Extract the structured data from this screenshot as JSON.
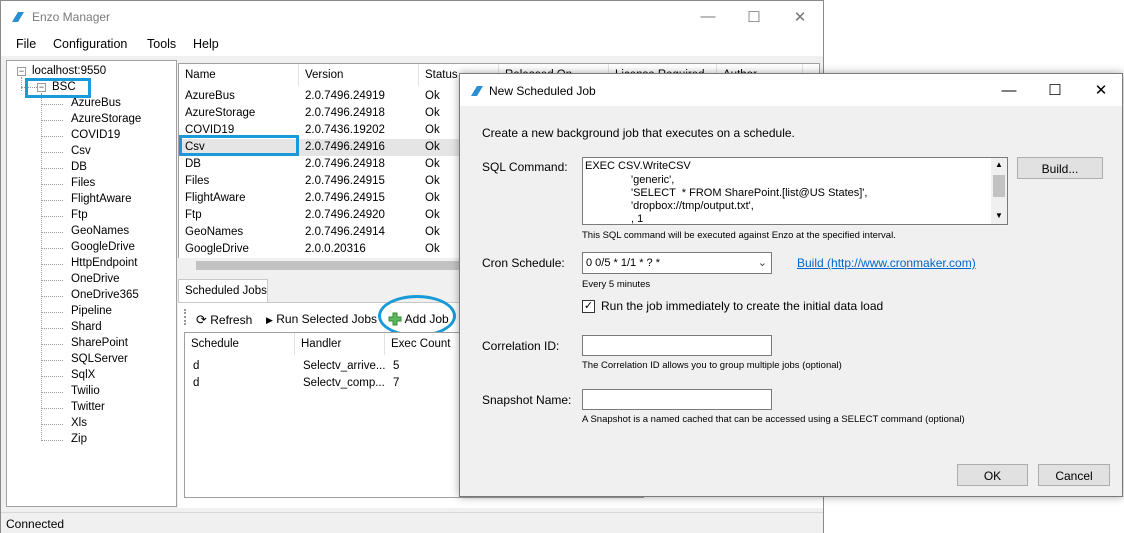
{
  "main_window": {
    "title": "Enzo Manager",
    "menu": [
      "File",
      "Configuration",
      "Tools",
      "Help"
    ],
    "menu_underline": [
      "F",
      "C",
      "",
      ""
    ],
    "status": "Connected"
  },
  "tree": {
    "root": "localhost:9550",
    "selected": "BSC",
    "items": [
      "AzureBus",
      "AzureStorage",
      "COVID19",
      "Csv",
      "DB",
      "Files",
      "FlightAware",
      "Ftp",
      "GeoNames",
      "GoogleDrive",
      "HttpEndpoint",
      "OneDrive",
      "OneDrive365",
      "Pipeline",
      "Shard",
      "SharePoint",
      "SQLServer",
      "SqlX",
      "Twilio",
      "Twitter",
      "Xls",
      "Zip"
    ]
  },
  "adapters_grid": {
    "headers": [
      "Name",
      "Version",
      "Status",
      "Released On",
      "License Required",
      "Author"
    ],
    "rows": [
      [
        "AzureBus",
        "2.0.7496.24919",
        "Ok"
      ],
      [
        "AzureStorage",
        "2.0.7496.24918",
        "Ok"
      ],
      [
        "COVID19",
        "2.0.7436.19202",
        "Ok"
      ],
      [
        "Csv",
        "2.0.7496.24916",
        "Ok"
      ],
      [
        "DB",
        "2.0.7496.24918",
        "Ok"
      ],
      [
        "Files",
        "2.0.7496.24915",
        "Ok"
      ],
      [
        "FlightAware",
        "2.0.7496.24915",
        "Ok"
      ],
      [
        "Ftp",
        "2.0.7496.24920",
        "Ok"
      ],
      [
        "GeoNames",
        "2.0.7496.24914",
        "Ok"
      ],
      [
        "GoogleDrive",
        "2.0.0.20316",
        "Ok"
      ]
    ]
  },
  "jobs": {
    "tab": "Scheduled Jobs",
    "refresh": "Refresh",
    "run_selected": "Run Selected Jobs",
    "add_job": "Add Job",
    "headers": [
      "Schedule",
      "Handler",
      "Exec Count"
    ],
    "rows": [
      [
        "d",
        "Selectv_arrive...",
        "5"
      ],
      [
        "d",
        "Selectv_comp...",
        "7"
      ]
    ]
  },
  "dialog": {
    "title": "New Scheduled Job",
    "intro": "Create a new background job that executes on a schedule.",
    "sql_label": "SQL Command:",
    "sql_lines": [
      "EXEC CSV.WriteCSV",
      "'generic',",
      "'SELECT  * FROM SharePoint.[list@US States]',",
      "'dropbox://tmp/output.txt',",
      ", 1"
    ],
    "sql_hint": "This SQL command will be executed against Enzo at the specified interval.",
    "build_button": "Build...",
    "cron_label": "Cron Schedule:",
    "cron_value": "0 0/5 * 1/1 * ? *",
    "cron_link": "Build (http://www.cronmaker.com)",
    "cron_hint": "Every 5 minutes",
    "run_now_label": "Run the job immediately to create the initial data load",
    "run_now_checked": true,
    "correlation_label": "Correlation ID:",
    "correlation_value": "",
    "correlation_hint": "The Correlation ID allows you to group multiple jobs (optional)",
    "snapshot_label": "Snapshot Name:",
    "snapshot_value": "",
    "snapshot_hint": "A Snapshot is a named cached that can be accessed using a SELECT command (optional)",
    "ok": "OK",
    "cancel": "Cancel"
  },
  "colors": {
    "highlight": "#1a9ad6",
    "selected_row": "#e5e5e5",
    "link": "#0066cc"
  }
}
